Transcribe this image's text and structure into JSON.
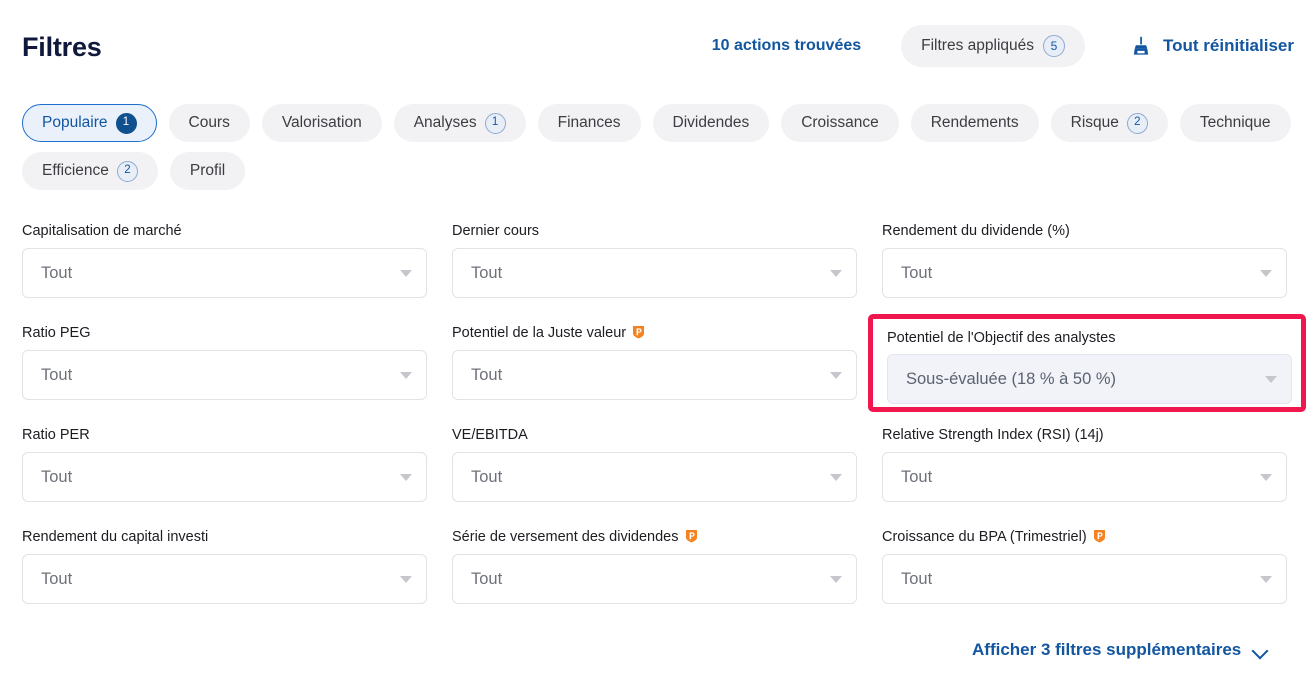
{
  "header": {
    "title": "Filtres",
    "results_count": "10 actions trouvées",
    "applied_filters_label": "Filtres appliqués",
    "applied_filters_count": "5",
    "reset_label": "Tout réinitialiser",
    "reset_icon": "broom-icon",
    "accent_blue": "#1256A0"
  },
  "tabs": [
    {
      "label": "Populaire",
      "badge": "1",
      "active": true
    },
    {
      "label": "Cours",
      "badge": "",
      "active": false
    },
    {
      "label": "Valorisation",
      "badge": "",
      "active": false
    },
    {
      "label": "Analyses",
      "badge": "1",
      "active": false
    },
    {
      "label": "Finances",
      "badge": "",
      "active": false
    },
    {
      "label": "Dividendes",
      "badge": "",
      "active": false
    },
    {
      "label": "Croissance",
      "badge": "",
      "active": false
    },
    {
      "label": "Rendements",
      "badge": "",
      "active": false
    },
    {
      "label": "Risque",
      "badge": "2",
      "active": false
    },
    {
      "label": "Technique",
      "badge": "",
      "active": false
    },
    {
      "label": "Efficience",
      "badge": "2",
      "active": false
    },
    {
      "label": "Profil",
      "badge": "",
      "active": false
    }
  ],
  "filters": [
    {
      "label": "Capitalisation de marché",
      "value": "Tout",
      "pro": false,
      "highlighted": false
    },
    {
      "label": "Dernier cours",
      "value": "Tout",
      "pro": false,
      "highlighted": false
    },
    {
      "label": "Rendement du dividende (%)",
      "value": "Tout",
      "pro": false,
      "highlighted": false
    },
    {
      "label": "Ratio PEG",
      "value": "Tout",
      "pro": false,
      "highlighted": false
    },
    {
      "label": "Potentiel de la Juste valeur",
      "value": "Tout",
      "pro": true,
      "highlighted": false
    },
    {
      "label": "Potentiel de l'Objectif des analystes",
      "value": "Sous-évaluée (18 % à 50 %)",
      "pro": false,
      "highlighted": true
    },
    {
      "label": "Ratio PER",
      "value": "Tout",
      "pro": false,
      "highlighted": false
    },
    {
      "label": "VE/EBITDA",
      "value": "Tout",
      "pro": false,
      "highlighted": false
    },
    {
      "label": "Relative Strength Index (RSI) (14j)",
      "value": "Tout",
      "pro": false,
      "highlighted": false
    },
    {
      "label": "Rendement du capital investi",
      "value": "Tout",
      "pro": false,
      "highlighted": false
    },
    {
      "label": "Série de versement des dividendes",
      "value": "Tout",
      "pro": true,
      "highlighted": false
    },
    {
      "label": "Croissance du BPA (Trimestriel)",
      "value": "Tout",
      "pro": true,
      "highlighted": false
    }
  ],
  "footer": {
    "more_filters_label": "Afficher 3 filtres supplémentaires",
    "chevron_icon": "chevron-down-icon"
  },
  "colors": {
    "highlight_border": "#F0174F",
    "pro_badge": "#F58220",
    "tab_active_border": "#1F6FD0",
    "badge_filled": "#11508F"
  }
}
